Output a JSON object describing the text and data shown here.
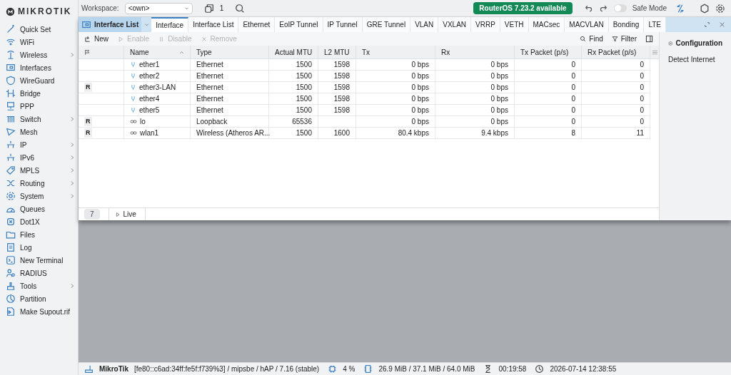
{
  "logo": {
    "text": "MIKROTIK"
  },
  "sidebar": {
    "items": [
      {
        "label": "Quick Set",
        "submenu": false
      },
      {
        "label": "WiFi",
        "submenu": false
      },
      {
        "label": "Wireless",
        "submenu": true
      },
      {
        "label": "Interfaces",
        "submenu": false
      },
      {
        "label": "WireGuard",
        "submenu": false
      },
      {
        "label": "Bridge",
        "submenu": false
      },
      {
        "label": "PPP",
        "submenu": false
      },
      {
        "label": "Switch",
        "submenu": true
      },
      {
        "label": "Mesh",
        "submenu": false
      },
      {
        "label": "IP",
        "submenu": true
      },
      {
        "label": "IPv6",
        "submenu": true
      },
      {
        "label": "MPLS",
        "submenu": true
      },
      {
        "label": "Routing",
        "submenu": true
      },
      {
        "label": "System",
        "submenu": true
      },
      {
        "label": "Queues",
        "submenu": false
      },
      {
        "label": "Dot1X",
        "submenu": false
      },
      {
        "label": "Files",
        "submenu": false
      },
      {
        "label": "Log",
        "submenu": false
      },
      {
        "label": "New Terminal",
        "submenu": false
      },
      {
        "label": "RADIUS",
        "submenu": false
      },
      {
        "label": "Tools",
        "submenu": true
      },
      {
        "label": "Partition",
        "submenu": false
      },
      {
        "label": "Make Supout.rif",
        "submenu": false
      }
    ]
  },
  "topbar": {
    "workspace_label": "Workspace:",
    "workspace_value": "<own>",
    "window_count": "1",
    "update_badge": "RouterOS 7.23.2 available",
    "safe_mode": {
      "label": "Safe Mode",
      "on": false
    }
  },
  "window": {
    "title": "Interface List",
    "tabs": [
      {
        "label": "Interface",
        "selected": true
      },
      {
        "label": "Interface List",
        "selected": false
      },
      {
        "label": "Ethernet",
        "selected": false
      },
      {
        "label": "EoIP Tunnel",
        "selected": false
      },
      {
        "label": "IP Tunnel",
        "selected": false
      },
      {
        "label": "GRE Tunnel",
        "selected": false
      },
      {
        "label": "VLAN",
        "selected": false
      },
      {
        "label": "VXLAN",
        "selected": false
      },
      {
        "label": "VRRP",
        "selected": false
      },
      {
        "label": "VETH",
        "selected": false
      },
      {
        "label": "MACsec",
        "selected": false
      },
      {
        "label": "MACVLAN",
        "selected": false
      },
      {
        "label": "Bonding",
        "selected": false
      },
      {
        "label": "LTE",
        "selected": false
      }
    ],
    "toolbar": [
      {
        "label": "New",
        "disabled": false
      },
      {
        "label": "Enable",
        "disabled": true
      },
      {
        "label": "Disable",
        "disabled": true
      },
      {
        "label": "Remove",
        "disabled": true
      }
    ],
    "find": "Find",
    "filter": "Filter"
  },
  "table": {
    "columns": [
      "Name",
      "Type",
      "Actual MTU",
      "L2 MTU",
      "Tx",
      "Rx",
      "Tx Packet (p/s)",
      "Rx Packet (p/s)"
    ],
    "rows": [
      {
        "flag": "",
        "kind": "ethernet",
        "cells": [
          "ether1",
          "Ethernet",
          "1500",
          "1598",
          "0 bps",
          "0 bps",
          "0",
          "0"
        ]
      },
      {
        "flag": "",
        "kind": "ethernet",
        "cells": [
          "ether2",
          "Ethernet",
          "1500",
          "1598",
          "0 bps",
          "0 bps",
          "0",
          "0"
        ]
      },
      {
        "flag": "R",
        "kind": "ethernet",
        "cells": [
          "ether3-LAN",
          "Ethernet",
          "1500",
          "1598",
          "0 bps",
          "0 bps",
          "0",
          "0"
        ]
      },
      {
        "flag": "",
        "kind": "ethernet",
        "cells": [
          "ether4",
          "Ethernet",
          "1500",
          "1598",
          "0 bps",
          "0 bps",
          "0",
          "0"
        ]
      },
      {
        "flag": "",
        "kind": "ethernet",
        "cells": [
          "ether5",
          "Ethernet",
          "1500",
          "1598",
          "0 bps",
          "0 bps",
          "0",
          "0"
        ]
      },
      {
        "flag": "R",
        "kind": "virtual",
        "cells": [
          "lo",
          "Loopback",
          "65536",
          "",
          "0 bps",
          "0 bps",
          "0",
          "0"
        ]
      },
      {
        "flag": "R",
        "kind": "virtual",
        "cells": [
          "wlan1",
          "Wireless (Atheros AR...",
          "1500",
          "1600",
          "80.4 kbps",
          "9.4 kbps",
          "8",
          "11"
        ]
      }
    ],
    "count": "7",
    "live": "Live"
  },
  "side_panel": {
    "title": "Configuration",
    "items": [
      "Detect Internet"
    ]
  },
  "status_bar": {
    "identity": "MikroTik",
    "details": "[fe80::c6ad:34ff:fe5f:f739%3] / mipsbe / hAP / 7.16 (stable)",
    "cpu": "4 %",
    "memory": "26.9 MiB / 37.1 MiB / 64.0 MiB",
    "uptime": "00:19:58",
    "clock": "2026-07-14 12:38:55"
  }
}
